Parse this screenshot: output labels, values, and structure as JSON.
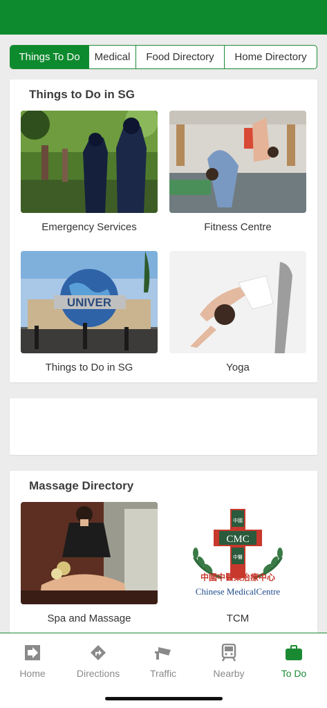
{
  "tabs": [
    {
      "label": "Things To Do",
      "active": true
    },
    {
      "label": "Medical",
      "active": false
    },
    {
      "label": "Food Directory",
      "active": false
    },
    {
      "label": "Home Directory",
      "active": false
    }
  ],
  "section1": {
    "title": "Things to Do in SG",
    "tiles": [
      {
        "label": "Emergency Services",
        "image": "police-officers-photo"
      },
      {
        "label": "Fitness Centre",
        "image": "gymnastics-class-photo"
      },
      {
        "label": "Things to Do in SG",
        "image": "universal-globe-photo",
        "sign_text": "UNIVER"
      },
      {
        "label": "Yoga",
        "image": "yoga-pose-photo"
      }
    ]
  },
  "section2": {
    "title": "Massage Directory",
    "tiles": [
      {
        "label": "Spa and Massage",
        "image": "massage-photo"
      },
      {
        "label": "TCM",
        "image": "cmc-logo",
        "logo_text": "CMC",
        "logo_chinese_top": "中國",
        "logo_chinese_bottom": "中醫",
        "logo_chinese_line": "中國中醫藥治療中心",
        "logo_english_line": "Chinese MedicalCentre"
      }
    ]
  },
  "bottom_nav": [
    {
      "label": "Home",
      "icon": "arrow-right-box-icon",
      "active": false
    },
    {
      "label": "Directions",
      "icon": "directions-sign-icon",
      "active": false
    },
    {
      "label": "Traffic",
      "icon": "traffic-camera-icon",
      "active": false
    },
    {
      "label": "Nearby",
      "icon": "train-icon",
      "active": false
    },
    {
      "label": "To Do",
      "icon": "briefcase-icon",
      "active": true
    }
  ],
  "colors": {
    "brand_green": "#0e8a2e",
    "inactive_gray": "#8a8a8a"
  }
}
